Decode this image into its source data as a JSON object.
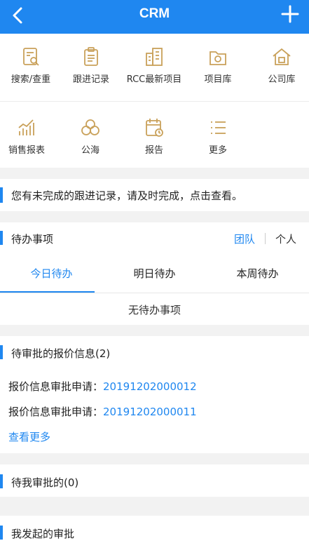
{
  "header": {
    "title": "CRM"
  },
  "grid": {
    "items": [
      {
        "label": "搜索/查重",
        "icon": "search-doc-icon"
      },
      {
        "label": "跟进记录",
        "icon": "clipboard-icon"
      },
      {
        "label": "RCC最新项目",
        "icon": "building-icon"
      },
      {
        "label": "项目库",
        "icon": "folder-icon"
      },
      {
        "label": "公司库",
        "icon": "house-icon"
      },
      {
        "label": "销售报表",
        "icon": "bar-chart-icon"
      },
      {
        "label": "公海",
        "icon": "cloud-icon"
      },
      {
        "label": "报告",
        "icon": "calendar-report-icon"
      },
      {
        "label": "更多",
        "icon": "list-icon"
      }
    ]
  },
  "notice": {
    "text": "您有未完成的跟进记录，请及时完成，点击查看。"
  },
  "todo": {
    "title": "待办事项",
    "switch_team": "团队",
    "switch_person": "个人",
    "tabs": [
      "今日待办",
      "明日待办",
      "本周待办"
    ],
    "empty_text": "无待办事项"
  },
  "quote": {
    "title": "待审批的报价信息(2)",
    "items": [
      {
        "label": "报价信息审批申请：",
        "id": "20191202000012"
      },
      {
        "label": "报价信息审批申请：",
        "id": "20191202000011"
      }
    ],
    "more": "查看更多"
  },
  "my_approval": {
    "title": "待我审批的(0)"
  },
  "started": {
    "title": "我发起的审批"
  },
  "colors": {
    "accent": "#1f87f0",
    "icon_gold": "#c9a15a",
    "background": "#f2f2f2"
  }
}
